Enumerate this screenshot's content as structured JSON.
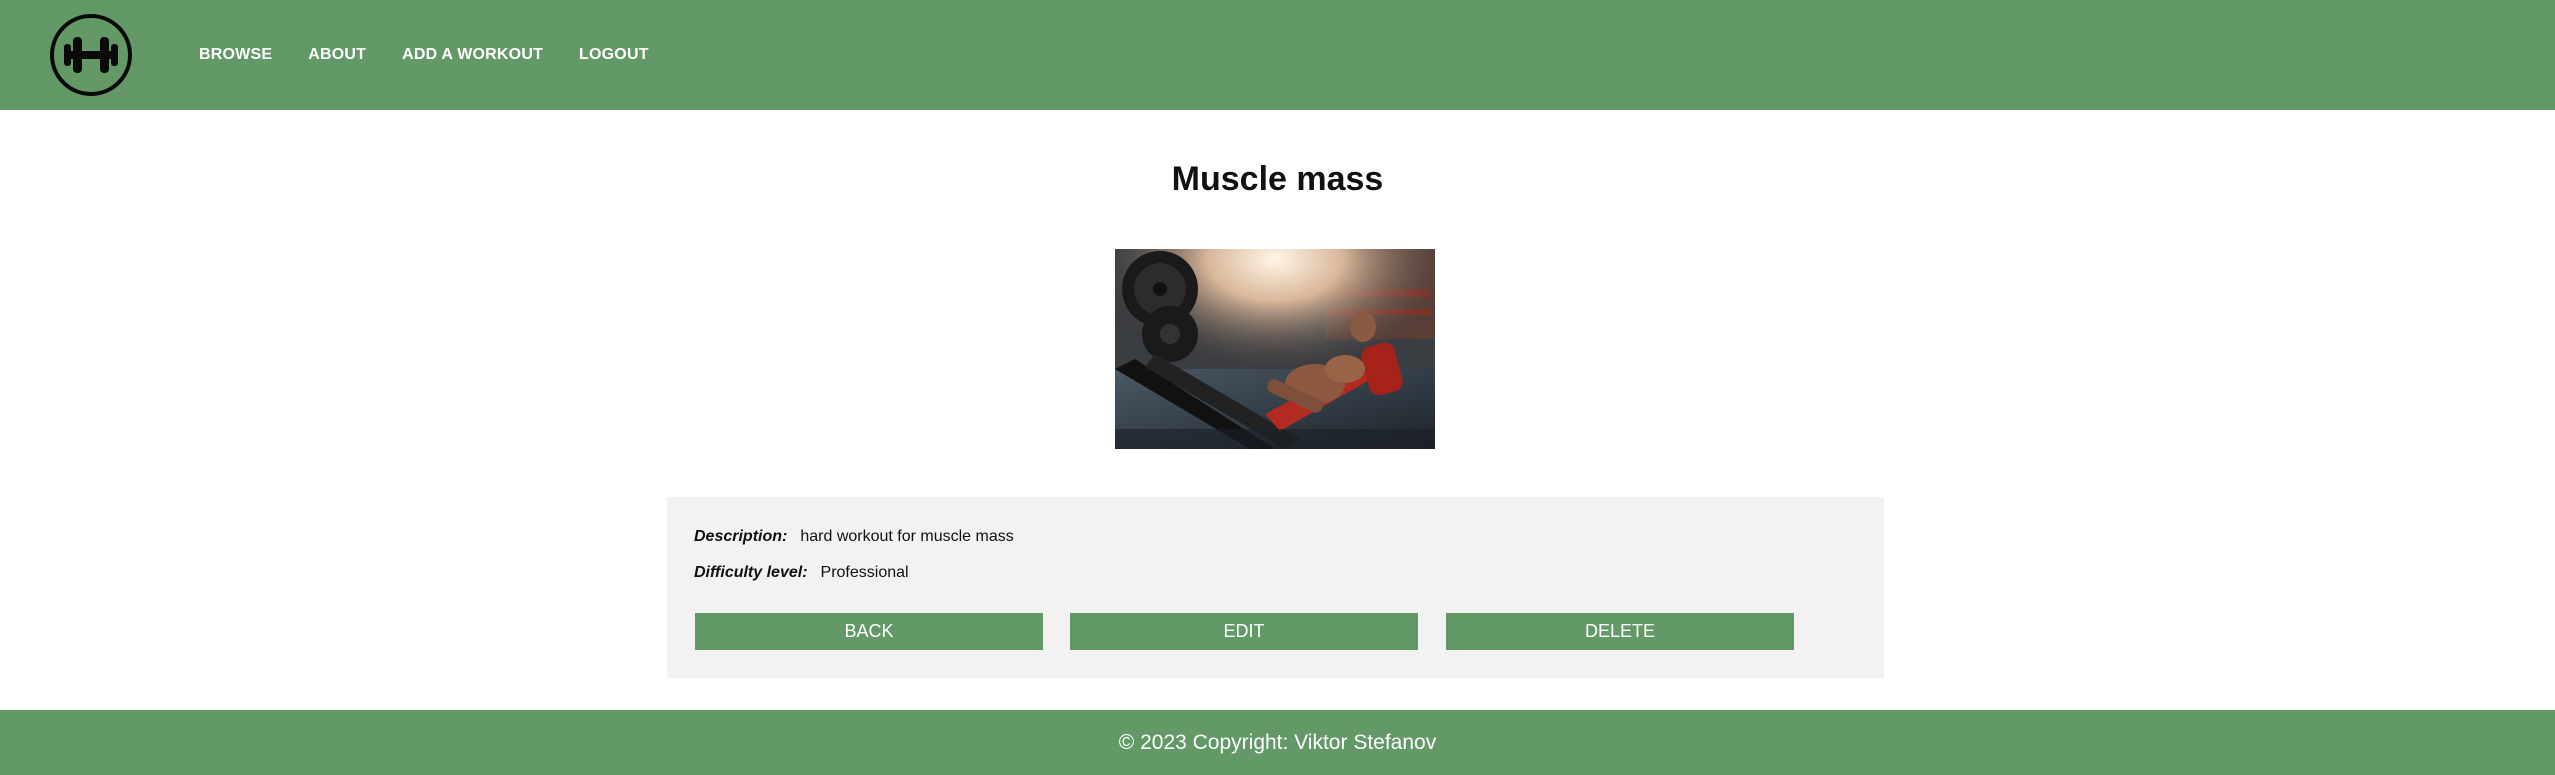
{
  "nav": {
    "logo_icon": "dumbbell-icon",
    "items": [
      {
        "label": "BROWSE"
      },
      {
        "label": "ABOUT"
      },
      {
        "label": "ADD A WORKOUT"
      },
      {
        "label": "LOGOUT"
      }
    ]
  },
  "workout": {
    "title": "Muscle mass",
    "image_alt": "man-on-leg-press-photo",
    "description_label": "Description:",
    "description": "hard workout for muscle mass",
    "difficulty_label": "Difficulty level:",
    "difficulty": "Professional"
  },
  "actions": {
    "back": "BACK",
    "edit": "EDIT",
    "delete": "DELETE"
  },
  "footer": {
    "text": "© 2023 Copyright: Viktor Stefanov"
  },
  "colors": {
    "brand_green": "#629966",
    "panel_bg": "#f2f2f2"
  }
}
